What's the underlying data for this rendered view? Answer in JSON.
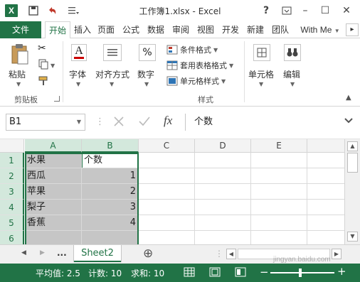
{
  "window": {
    "title": "工作簿1.xlsx - Excel",
    "help": "?",
    "minimize": "–",
    "maximize": "☐",
    "close": "✕"
  },
  "ribbon_tabs": {
    "file": "文件",
    "items": [
      "开始",
      "插入",
      "页面",
      "公式",
      "数据",
      "审阅",
      "视图",
      "开发",
      "新建",
      "团队"
    ],
    "account": "With Me",
    "active": "开始"
  },
  "ribbon": {
    "paste": "粘贴",
    "clipboard_group": "剪贴板",
    "font": "字体",
    "alignment": "对齐方式",
    "number": "数字",
    "conditional_format": "条件格式",
    "table_format": "套用表格格式",
    "cell_style": "单元格样式",
    "styles_group": "样式",
    "cells": "单元格",
    "editing": "编辑",
    "percent_symbol": "%",
    "font_symbol": "A"
  },
  "formula_bar": {
    "name_box": "B1",
    "fx": "fx",
    "content": "个数"
  },
  "grid": {
    "columns": [
      "A",
      "B",
      "C",
      "D",
      "E",
      "F"
    ],
    "selected_columns": [
      "A",
      "B"
    ],
    "rows": [
      "1",
      "2",
      "3",
      "4",
      "5",
      "6"
    ],
    "cells": [
      [
        "水果",
        "个数"
      ],
      [
        "西瓜",
        "1"
      ],
      [
        "苹果",
        "2"
      ],
      [
        "梨子",
        "3"
      ],
      [
        "香蕉",
        "4"
      ],
      [
        "",
        ""
      ]
    ]
  },
  "sheets": {
    "ellipsis": "...",
    "active": "Sheet2",
    "add": "⊕"
  },
  "status": {
    "average": "平均值: 2.5",
    "count": "计数: 10",
    "sum": "求和: 10"
  },
  "watermark": "jingyan.baidu.com",
  "colors": {
    "excel_green": "#217346",
    "selection_gray": "#c6c6c6",
    "header_selected": "#d3e8dc"
  }
}
